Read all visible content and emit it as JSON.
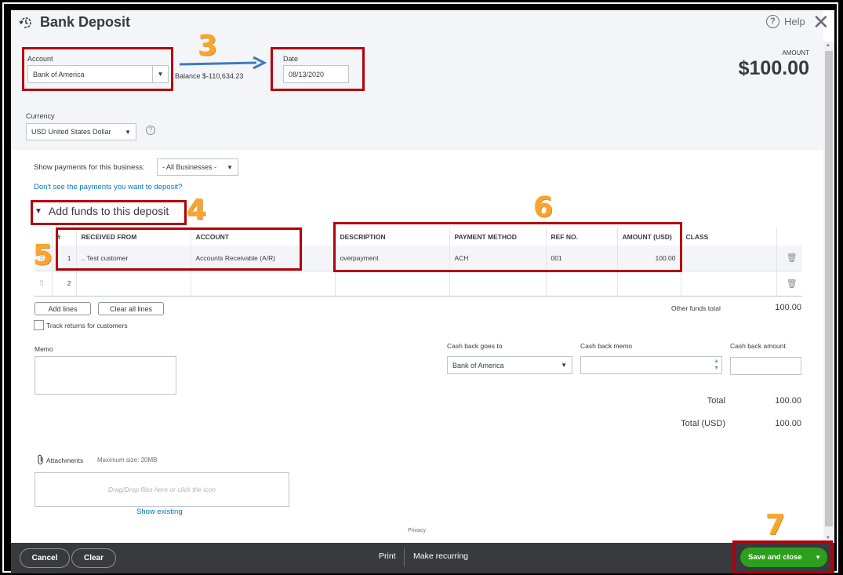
{
  "window": {
    "title": "Bank Deposit",
    "help_label": "Help"
  },
  "header": {
    "account_label": "Account",
    "account_value": "Bank of America",
    "balance_text": "Balance $-110,634.23",
    "date_label": "Date",
    "date_value": "08/13/2020",
    "amount_label": "AMOUNT",
    "amount_value": "$100.00",
    "currency_label": "Currency",
    "currency_value": "USD United States Dollar"
  },
  "filters": {
    "show_payments_label": "Show payments for this business:",
    "business_value": "- All Businesses -",
    "missing_payments_link": "Don't see the payments you want to deposit?"
  },
  "funds_section": {
    "title": "Add funds to this deposit",
    "columns": [
      "#",
      "RECEIVED FROM",
      "ACCOUNT",
      "DESCRIPTION",
      "PAYMENT METHOD",
      "REF NO.",
      "AMOUNT (USD)",
      "CLASS"
    ],
    "rows": [
      {
        "num": "1",
        "received_from": ".. Test customer",
        "account": "Accounts Receivable (A/R)",
        "description": "overpayment",
        "payment_method": "ACH",
        "ref_no": "001",
        "amount": "100.00",
        "class": ""
      },
      {
        "num": "2",
        "received_from": "",
        "account": "",
        "description": "",
        "payment_method": "",
        "ref_no": "",
        "amount": "",
        "class": ""
      }
    ],
    "add_lines_label": "Add lines",
    "clear_lines_label": "Clear all lines",
    "other_funds_total_label": "Other funds total",
    "other_funds_total_value": "100.00",
    "track_returns_label": "Track returns for customers"
  },
  "memo": {
    "label": "Memo",
    "value": ""
  },
  "cash_back": {
    "goes_to_label": "Cash back goes to",
    "goes_to_value": "Bank of America",
    "memo_label": "Cash back memo",
    "memo_value": "",
    "amount_label": "Cash back amount",
    "amount_value": ""
  },
  "totals": {
    "total_label": "Total",
    "total_value": "100.00",
    "total_usd_label": "Total (USD)",
    "total_usd_value": "100.00"
  },
  "attachments": {
    "label": "Attachments",
    "max_size": "Maximum size: 20MB",
    "drop_hint": "Drag/Drop files here or click the icon",
    "show_existing": "Show existing"
  },
  "privacy_label": "Privacy",
  "footer": {
    "cancel": "Cancel",
    "clear": "Clear",
    "print": "Print",
    "make_recurring": "Make recurring",
    "save_and_close": "Save and close"
  },
  "annotations": {
    "step3": "3",
    "step4": "4",
    "step5": "5",
    "step6": "6",
    "step7": "7",
    "highlight_color": "#b4000a",
    "number_color": "#f7a531",
    "arrow_color": "#3f7ac0"
  },
  "icons": {
    "title": "history-clock-icon",
    "help": "question-circle-icon",
    "close": "close-x-icon",
    "caret": "▼",
    "collapse": "▼",
    "trash": "🗑",
    "drag": "⠿",
    "paperclip": "paperclip-icon"
  }
}
